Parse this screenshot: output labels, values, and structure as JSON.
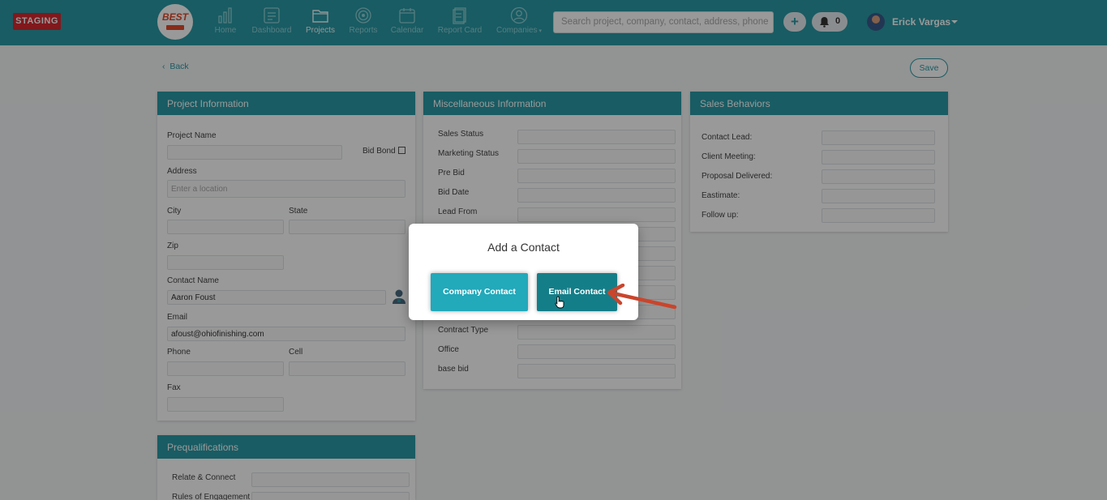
{
  "header": {
    "badge": "STAGING",
    "logo_text": "BEST",
    "nav": [
      {
        "label": "Home",
        "icon": "bar-chart-icon"
      },
      {
        "label": "Dashboard",
        "icon": "dashboard-icon"
      },
      {
        "label": "Projects",
        "icon": "folder-icon",
        "active": true
      },
      {
        "label": "Reports",
        "icon": "target-icon"
      },
      {
        "label": "Calendar",
        "icon": "calendar-icon"
      },
      {
        "label": "Report Card",
        "icon": "report-card-icon"
      },
      {
        "label": "Companies",
        "icon": "user-icon",
        "has_dropdown": true
      }
    ],
    "search_placeholder": "Search project, company, contact, address, phone",
    "plus_label": "+",
    "notification_count": "0",
    "user_name": "Erick Vargas"
  },
  "page": {
    "back_label": "Back",
    "save_label": "Save"
  },
  "project_info": {
    "title": "Project Information",
    "project_name_label": "Project Name",
    "project_name_value": "",
    "bid_bond_label": "Bid Bond",
    "address_label": "Address",
    "address_placeholder": "Enter a location",
    "city_label": "City",
    "state_label": "State",
    "zip_label": "Zip",
    "contact_name_label": "Contact Name",
    "contact_name_value": "Aaron Foust",
    "email_label": "Email",
    "email_value": "afoust@ohiofinishing.com",
    "phone_label": "Phone",
    "cell_label": "Cell",
    "fax_label": "Fax"
  },
  "misc_info": {
    "title": "Miscellaneous Information",
    "fields": [
      "Sales Status",
      "Marketing Status",
      "Pre Bid",
      "Bid Date",
      "Lead From",
      "",
      "",
      "",
      "",
      "Contract Type",
      "Office",
      "base bid"
    ]
  },
  "sales_behaviors": {
    "title": "Sales Behaviors",
    "fields": [
      "Contact Lead:",
      "Client Meeting:",
      "Proposal Delivered:",
      "Eastimate:",
      "Follow up:"
    ]
  },
  "prequalifications": {
    "title": "Prequalifications",
    "fields": [
      "Relate & Connect",
      "Rules of Engagement"
    ]
  },
  "modal": {
    "title": "Add a Contact",
    "company_contact_label": "Company Contact",
    "email_contact_label": "Email Contact"
  },
  "colors": {
    "primary": "#2a9aa6",
    "staging": "#d7282f",
    "annotation_arrow": "#c9452c"
  }
}
